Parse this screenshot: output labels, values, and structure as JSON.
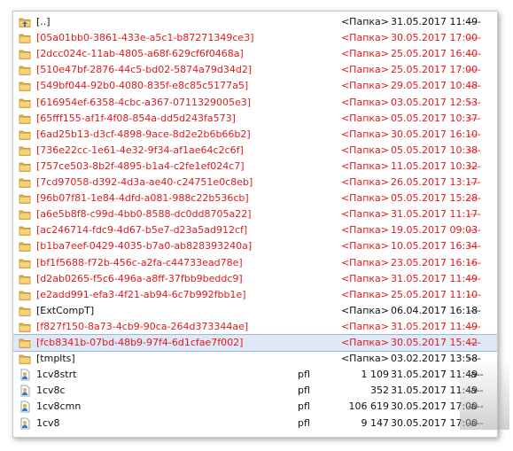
{
  "panel": {
    "rows": [
      {
        "name": "[..]",
        "ext": "",
        "size": "<Папка>",
        "date": "31.05.2017 11:49",
        "attr": "----",
        "color": "black",
        "icon": "up-folder-icon"
      },
      {
        "name": "[05a01bb0-3861-433e-a5c1-b87271349ce3]",
        "ext": "",
        "size": "<Папка>",
        "date": "30.05.2017 17:00",
        "attr": "----",
        "color": "red",
        "icon": "folder-icon"
      },
      {
        "name": "[2dcc024c-11ab-4805-a68f-629cf6f0468a]",
        "ext": "",
        "size": "<Папка>",
        "date": "25.05.2017 16:40",
        "attr": "----",
        "color": "red",
        "icon": "folder-icon"
      },
      {
        "name": "[510e47bf-2876-44c5-bd02-5874a79d34d2]",
        "ext": "",
        "size": "<Папка>",
        "date": "25.05.2017 17:00",
        "attr": "----",
        "color": "red",
        "icon": "folder-icon"
      },
      {
        "name": "[549bf044-92b0-4080-835f-e8c85c5177a5]",
        "ext": "",
        "size": "<Папка>",
        "date": "29.05.2017 10:48",
        "attr": "----",
        "color": "red",
        "icon": "folder-icon"
      },
      {
        "name": "[616954ef-6358-4cbc-a367-0711329005e3]",
        "ext": "",
        "size": "<Папка>",
        "date": "03.05.2017 12:53",
        "attr": "----",
        "color": "red",
        "icon": "folder-icon"
      },
      {
        "name": "[65fff155-af1f-4f08-854a-dd5d243fa573]",
        "ext": "",
        "size": "<Папка>",
        "date": "05.05.2017 10:37",
        "attr": "----",
        "color": "red",
        "icon": "folder-icon"
      },
      {
        "name": "[6ad25b13-d3cf-4898-9ace-8d2e2b6b66b2]",
        "ext": "",
        "size": "<Папка>",
        "date": "30.05.2017 16:10",
        "attr": "----",
        "color": "red",
        "icon": "folder-icon"
      },
      {
        "name": "[736e22cc-1e61-4e32-9f34-af1ae64c2c6f]",
        "ext": "",
        "size": "<Папка>",
        "date": "05.05.2017 10:38",
        "attr": "----",
        "color": "red",
        "icon": "folder-icon"
      },
      {
        "name": "[757ce503-8b2f-4895-b1a4-c2fe1ef024c7]",
        "ext": "",
        "size": "<Папка>",
        "date": "11.05.2017 10:32",
        "attr": "----",
        "color": "red",
        "icon": "folder-icon"
      },
      {
        "name": "[7cd97058-d392-4d3a-ae40-c24751e0c8eb]",
        "ext": "",
        "size": "<Папка>",
        "date": "26.05.2017 13:17",
        "attr": "----",
        "color": "red",
        "icon": "folder-icon"
      },
      {
        "name": "[96b07f81-1e84-4dfd-a081-988c22b536cb]",
        "ext": "",
        "size": "<Папка>",
        "date": "05.05.2017 15:28",
        "attr": "----",
        "color": "red",
        "icon": "folder-icon"
      },
      {
        "name": "[a6e5b8f8-c99d-4bb0-8588-dc0dd8705a22]",
        "ext": "",
        "size": "<Папка>",
        "date": "31.05.2017 11:17",
        "attr": "----",
        "color": "red",
        "icon": "folder-icon"
      },
      {
        "name": "[ac246714-fdc9-4d67-b5e7-d23a5ad912cf]",
        "ext": "",
        "size": "<Папка>",
        "date": "19.05.2017 09:03",
        "attr": "----",
        "color": "red",
        "icon": "folder-icon"
      },
      {
        "name": "[b1ba7eef-0429-4035-b7a0-ab828393240a]",
        "ext": "",
        "size": "<Папка>",
        "date": "10.05.2017 16:34",
        "attr": "----",
        "color": "red",
        "icon": "folder-icon"
      },
      {
        "name": "[bf1f5688-f72b-456c-a2fa-c44733ead78e]",
        "ext": "",
        "size": "<Папка>",
        "date": "23.05.2017 16:16",
        "attr": "----",
        "color": "red",
        "icon": "folder-icon"
      },
      {
        "name": "[d2ab0265-f5c6-496a-a8ff-37fbb9beddc9]",
        "ext": "",
        "size": "<Папка>",
        "date": "31.05.2017 11:49",
        "attr": "----",
        "color": "red",
        "icon": "folder-icon"
      },
      {
        "name": "[e2add991-efa3-4f21-ab94-6c7b992fbb1e]",
        "ext": "",
        "size": "<Папка>",
        "date": "25.05.2017 11:10",
        "attr": "----",
        "color": "red",
        "icon": "folder-icon"
      },
      {
        "name": "[ExtCompT]",
        "ext": "",
        "size": "<Папка>",
        "date": "06.04.2017 16:18",
        "attr": "----",
        "color": "black",
        "icon": "folder-icon"
      },
      {
        "name": "[f827f150-8a73-4cb9-90ca-264d373344ae]",
        "ext": "",
        "size": "<Папка>",
        "date": "31.05.2017 11:49",
        "attr": "----",
        "color": "red",
        "icon": "folder-icon"
      },
      {
        "name": "[fcb8341b-07bd-48b9-97f4-6d1cfae7f002]",
        "ext": "",
        "size": "<Папка>",
        "date": "30.05.2017 15:42",
        "attr": "----",
        "color": "red",
        "icon": "folder-icon",
        "selected": true
      },
      {
        "name": "[tmplts]",
        "ext": "",
        "size": "<Папка>",
        "date": "03.02.2017 13:58",
        "attr": "----",
        "color": "black",
        "icon": "folder-icon"
      },
      {
        "name": "1cv8strt",
        "ext": "pfl",
        "size": "1 109",
        "date": "31.05.2017 11:49",
        "attr": "-a--",
        "color": "black",
        "icon": "file-icon"
      },
      {
        "name": "1cv8c",
        "ext": "pfl",
        "size": "352",
        "date": "31.05.2017 11:49",
        "attr": "-a--",
        "color": "black",
        "icon": "file-icon"
      },
      {
        "name": "1cv8cmn",
        "ext": "pfl",
        "size": "106 619",
        "date": "30.05.2017 17:00",
        "attr": "-a--",
        "color": "black",
        "icon": "file-icon"
      },
      {
        "name": "1cv8",
        "ext": "pfl",
        "size": "9 147",
        "date": "30.05.2017 17:00",
        "attr": "-a--",
        "color": "black",
        "icon": "file-icon"
      }
    ]
  },
  "colors": {
    "red": "#e0191c",
    "black": "#111111",
    "folder": "#e8b64a",
    "selection": "#dfe8f7"
  }
}
